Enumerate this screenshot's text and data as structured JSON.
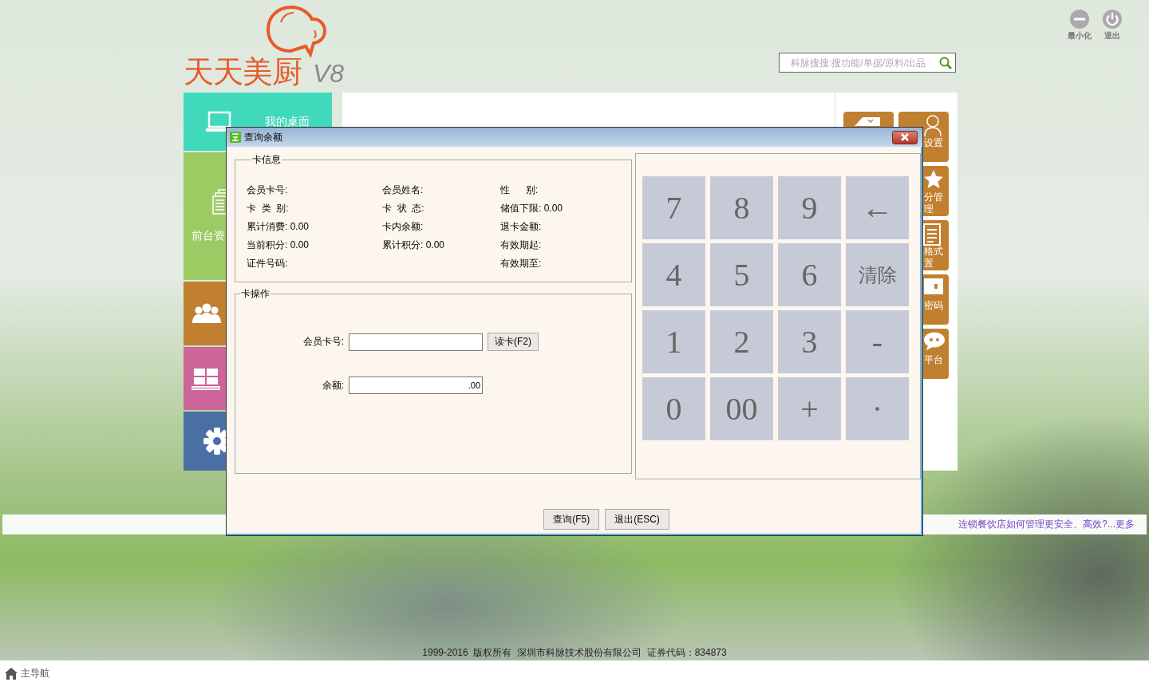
{
  "logo": {
    "name": "天天美厨",
    "version": "V8"
  },
  "top_buttons": [
    {
      "label": "最小化",
      "kind": "minimize"
    },
    {
      "label": "退出",
      "kind": "power"
    }
  ],
  "search": {
    "placeholder": "科脉搜搜:搜功能/单据/原料/出品"
  },
  "left_tiles": [
    {
      "kind": "desktop",
      "label": "我的桌面"
    },
    {
      "kind": "documents",
      "label": "前台资"
    },
    {
      "kind": "people"
    },
    {
      "kind": "grid"
    },
    {
      "kind": "gear"
    }
  ],
  "right_tiles": [
    {
      "kind": "tag"
    },
    {
      "kind": "person",
      "label": "设置"
    },
    {
      "kind": "star",
      "label": "分管理"
    },
    {
      "kind": "form",
      "label": "格式置"
    },
    {
      "kind": "key",
      "label": "密码"
    },
    {
      "kind": "chat",
      "label": "平台"
    }
  ],
  "dialog": {
    "title": "查询余额",
    "card_info": {
      "legend": "卡信息",
      "columns": [
        [
          "会员卡号:",
          "卡  类  别:",
          "累计消费: 0.00",
          "当前积分: 0.00",
          "证件号码:"
        ],
        [
          "会员姓名:",
          "卡  状  态:",
          "卡内余额:",
          "累计积分: 0.00"
        ],
        [
          "性      别:",
          "储值下限: 0.00",
          "退卡金额:",
          "有效期起:",
          "有效期至:"
        ]
      ]
    },
    "card_ops": {
      "legend": "卡操作",
      "card_label": "会员卡号:",
      "read_button": "读卡(F2)",
      "balance_label": "余额:",
      "balance_value": ".00"
    },
    "keypad": [
      "7",
      "8",
      "9",
      "←",
      "4",
      "5",
      "6",
      "清除",
      "1",
      "2",
      "3",
      "-",
      "0",
      "00",
      "+",
      "·"
    ],
    "buttons": [
      "查询(F5)",
      "退出(ESC)"
    ]
  },
  "news": {
    "headline": "连锁餐饮店如何管理更安全、高效?...",
    "link": "更多"
  },
  "copyright": "1999-2016  版权所有  深圳市科脉技术股份有限公司  证券代码：834873",
  "nav": {
    "label": "主导航"
  }
}
